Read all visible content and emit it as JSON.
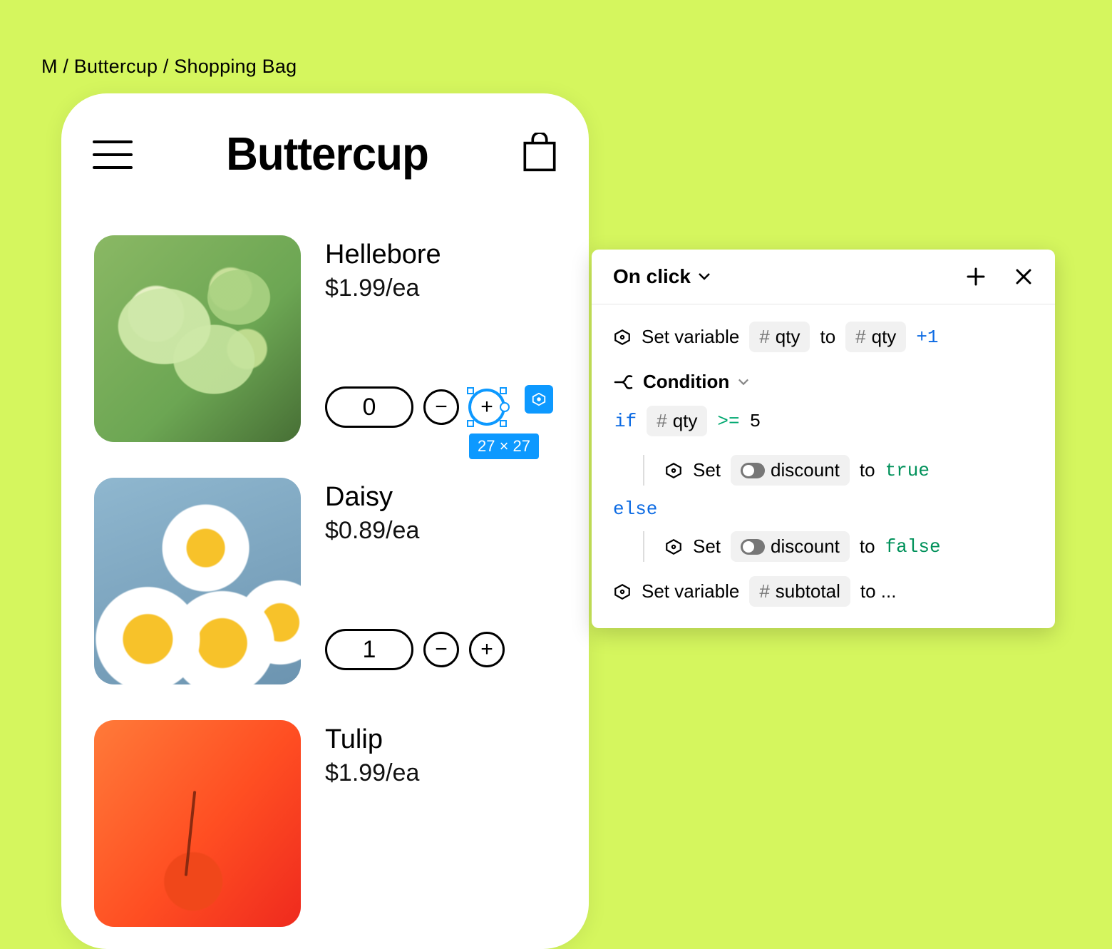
{
  "breadcrumb": "M / Buttercup / Shopping Bag",
  "app": {
    "title": "Buttercup"
  },
  "items": [
    {
      "name": "Hellebore",
      "price": "$1.99/ea",
      "qty": "0"
    },
    {
      "name": "Daisy",
      "price": "$0.89/ea",
      "qty": "1"
    },
    {
      "name": "Tulip",
      "price": "$1.99/ea"
    }
  ],
  "selection": {
    "size_label": "27 × 27"
  },
  "panel": {
    "trigger": "On click",
    "action1": {
      "label": "Set variable",
      "var": "qty",
      "to_kw": "to",
      "expr_var": "qty",
      "expr_suffix": "+1"
    },
    "condition": {
      "title": "Condition",
      "if_kw": "if",
      "var": "qty",
      "op": ">=",
      "rhs": "5",
      "then": {
        "label": "Set",
        "var": "discount",
        "to_kw": "to",
        "value": "true"
      },
      "else_kw": "else",
      "else": {
        "label": "Set",
        "var": "discount",
        "to_kw": "to",
        "value": "false"
      }
    },
    "action2": {
      "label": "Set variable",
      "var": "subtotal",
      "to_kw": "to ..."
    }
  }
}
